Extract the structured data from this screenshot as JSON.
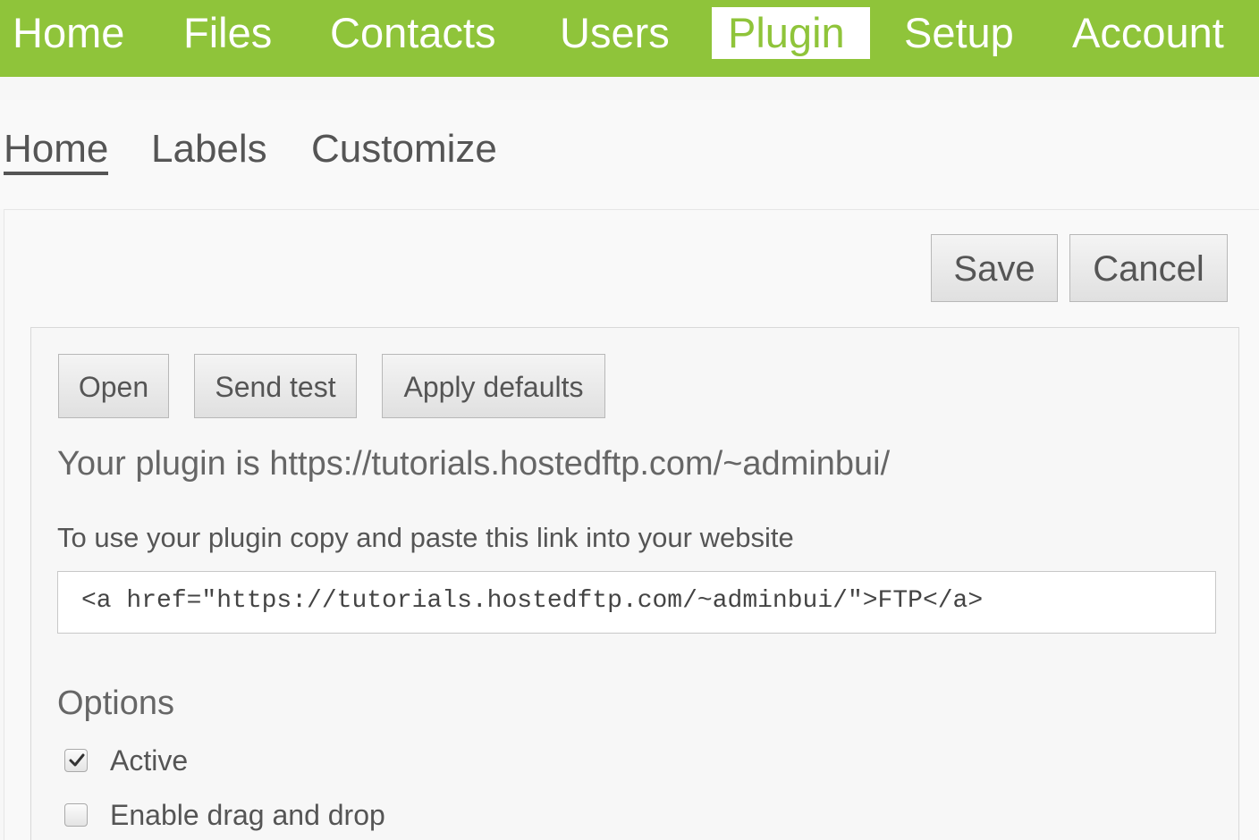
{
  "topnav": {
    "items": [
      {
        "label": "Home"
      },
      {
        "label": "Files"
      },
      {
        "label": "Contacts"
      },
      {
        "label": "Users"
      },
      {
        "label": "Plugin",
        "active": true
      },
      {
        "label": "Setup"
      },
      {
        "label": "Account"
      }
    ]
  },
  "subnav": {
    "items": [
      {
        "label": "Home",
        "active": true
      },
      {
        "label": "Labels"
      },
      {
        "label": "Customize"
      }
    ]
  },
  "actions": {
    "save_label": "Save",
    "cancel_label": "Cancel"
  },
  "plugin": {
    "buttons": {
      "open_label": "Open",
      "send_test_label": "Send test",
      "apply_defaults_label": "Apply defaults"
    },
    "url_text": "Your plugin is https://tutorials.hostedftp.com/~adminbui/",
    "instructions": "To use your plugin copy and paste this link into your website",
    "embed_code": "<a href=\"https://tutorials.hostedftp.com/~adminbui/\">FTP</a>"
  },
  "options": {
    "title": "Options",
    "items": [
      {
        "label": "Active",
        "checked": true
      },
      {
        "label": "Enable drag and drop",
        "checked": false
      }
    ]
  },
  "colors": {
    "brand_green": "#8fc43a"
  }
}
